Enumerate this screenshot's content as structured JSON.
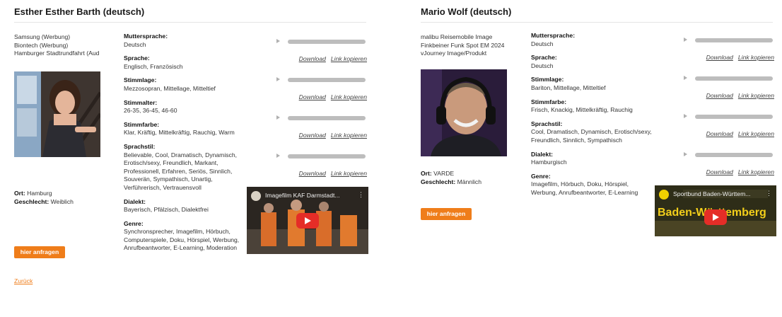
{
  "left": {
    "title": "Esther Esther Barth (deutsch)",
    "credits": [
      "Samsung (Werbung)",
      "Biontech (Werbung)",
      "Hamburger Stadtrundfahrt (Aud"
    ],
    "location_label": "Ort:",
    "location_value": "Hamburg",
    "gender_label": "Geschlecht:",
    "gender_value": "Weiblich",
    "request_button": "hier anfragen",
    "back_link": "Zurück",
    "attributes": [
      {
        "label": "Muttersprache:",
        "value": "Deutsch"
      },
      {
        "label": "Sprache:",
        "value": "Englisch, Französisch"
      },
      {
        "label": "Stimmlage:",
        "value": "Mezzosopran, Mittellage, Mitteltief"
      },
      {
        "label": "Stimmalter:",
        "value": "26-35, 36-45, 46-60"
      },
      {
        "label": "Stimmfarbe:",
        "value": "Klar, Kräftig, Mittelkräftig, Rauchig, Warm"
      },
      {
        "label": "Sprachstil:",
        "value": "Believable, Cool, Dramatisch, Dynamisch, Erotisch/sexy, Freundlich, Markant, Professionell, Erfahren, Seriös, Sinnlich, Souverän, Sympathisch, Unartig, Verführerisch, Vertrauensvoll"
      },
      {
        "label": "Dialekt:",
        "value": "Bayerisch, Pfälzisch, Dialektfrei"
      },
      {
        "label": "Genre:",
        "value": "Synchronsprecher, Imagefilm, Hörbuch, Computerspiele, Doku, Hörspiel, Werbung, Anrufbeantworter, E-Learning, Moderation"
      }
    ],
    "audio_links": {
      "download": "Download",
      "copy": "Link kopieren"
    },
    "video": {
      "title": "Imagefilm KAF Darmstadt..."
    }
  },
  "right": {
    "title": "Mario Wolf (deutsch)",
    "credits": [
      "malibu Reisemobile Image",
      "Finkbeiner Funk Spot EM 2024",
      "vJourney Image/Produkt"
    ],
    "location_label": "Ort:",
    "location_value": "VARDE",
    "gender_label": "Geschlecht:",
    "gender_value": "Männlich",
    "request_button": "hier anfragen",
    "attributes": [
      {
        "label": "Muttersprache:",
        "value": "Deutsch"
      },
      {
        "label": "Sprache:",
        "value": "Deutsch"
      },
      {
        "label": "Stimmlage:",
        "value": "Bariton, Mittellage, Mitteltief"
      },
      {
        "label": "Stimmfarbe:",
        "value": "Frisch, Knackig, Mittelkräftig, Rauchig"
      },
      {
        "label": "Sprachstil:",
        "value": "Cool, Dramatisch, Dynamisch, Erotisch/sexy, Freundlich, Sinnlich, Sympathisch"
      },
      {
        "label": "Dialekt:",
        "value": "Hamburgisch"
      },
      {
        "label": "Genre:",
        "value": "Imagefilm, Hörbuch, Doku, Hörspiel, Werbung, Anrufbeantworter, E-Learning"
      }
    ],
    "audio_links": {
      "download": "Download",
      "copy": "Link kopieren"
    },
    "video": {
      "title": "Sportbund Baden-Württem...",
      "overlay_text": "Baden-Württemberg"
    }
  }
}
